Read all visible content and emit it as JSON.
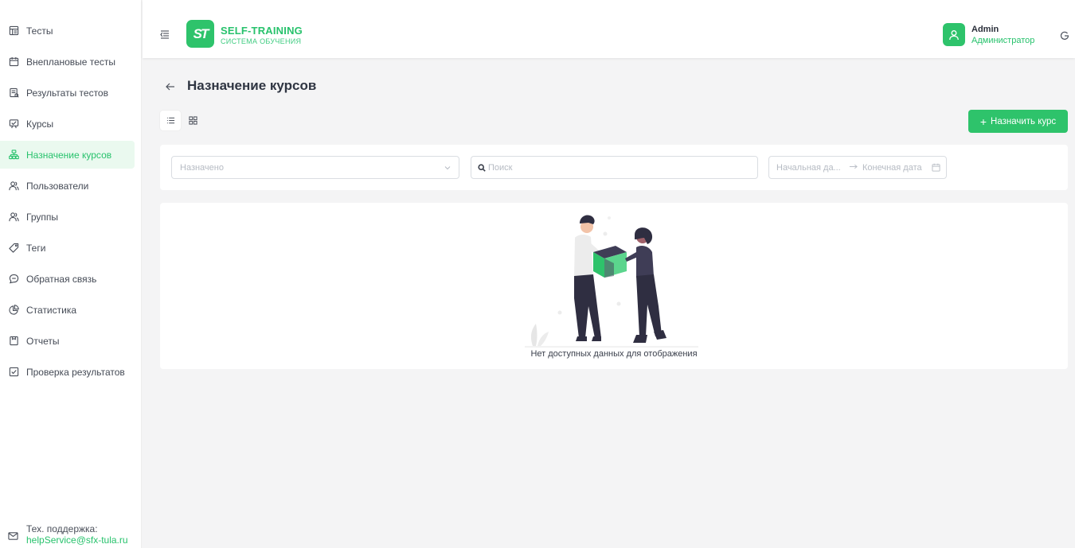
{
  "sidebar": {
    "items": [
      {
        "label": "Тесты",
        "icon": "tests-icon"
      },
      {
        "label": "Внеплановые тесты",
        "icon": "calendar-icon"
      },
      {
        "label": "Результаты тестов",
        "icon": "results-icon"
      },
      {
        "label": "Курсы",
        "icon": "courses-icon"
      },
      {
        "label": "Назначение курсов",
        "icon": "assign-icon",
        "active": true
      },
      {
        "label": "Пользователи",
        "icon": "users-icon"
      },
      {
        "label": "Группы",
        "icon": "groups-icon"
      },
      {
        "label": "Теги",
        "icon": "tag-icon"
      },
      {
        "label": "Обратная связь",
        "icon": "feedback-icon"
      },
      {
        "label": "Статистика",
        "icon": "pie-chart-icon"
      },
      {
        "label": "Отчеты",
        "icon": "report-icon"
      },
      {
        "label": "Проверка результатов",
        "icon": "checkbox-icon"
      }
    ],
    "support": {
      "label": "Тех. поддержка:",
      "email": "helpService@sfx-tula.ru"
    }
  },
  "header": {
    "logo_mark": "ST",
    "logo_title": "SELF-TRAINING",
    "logo_subtitle": "СИСТЕМА ОБУЧЕНИЯ",
    "user_name": "Admin",
    "user_role": "Администратор"
  },
  "page": {
    "title": "Назначение курсов",
    "assign_button": "Назначить курс"
  },
  "filters": {
    "status_placeholder": "Назначено",
    "search_placeholder": "Поиск",
    "start_date_placeholder": "Начальная да...",
    "end_date_placeholder": "Конечная дата"
  },
  "empty": {
    "message": "Нет доступных данных для отображения"
  },
  "colors": {
    "accent": "#2ec36b",
    "accent_light": "#eaf9ef",
    "background": "#f4f4f5"
  }
}
